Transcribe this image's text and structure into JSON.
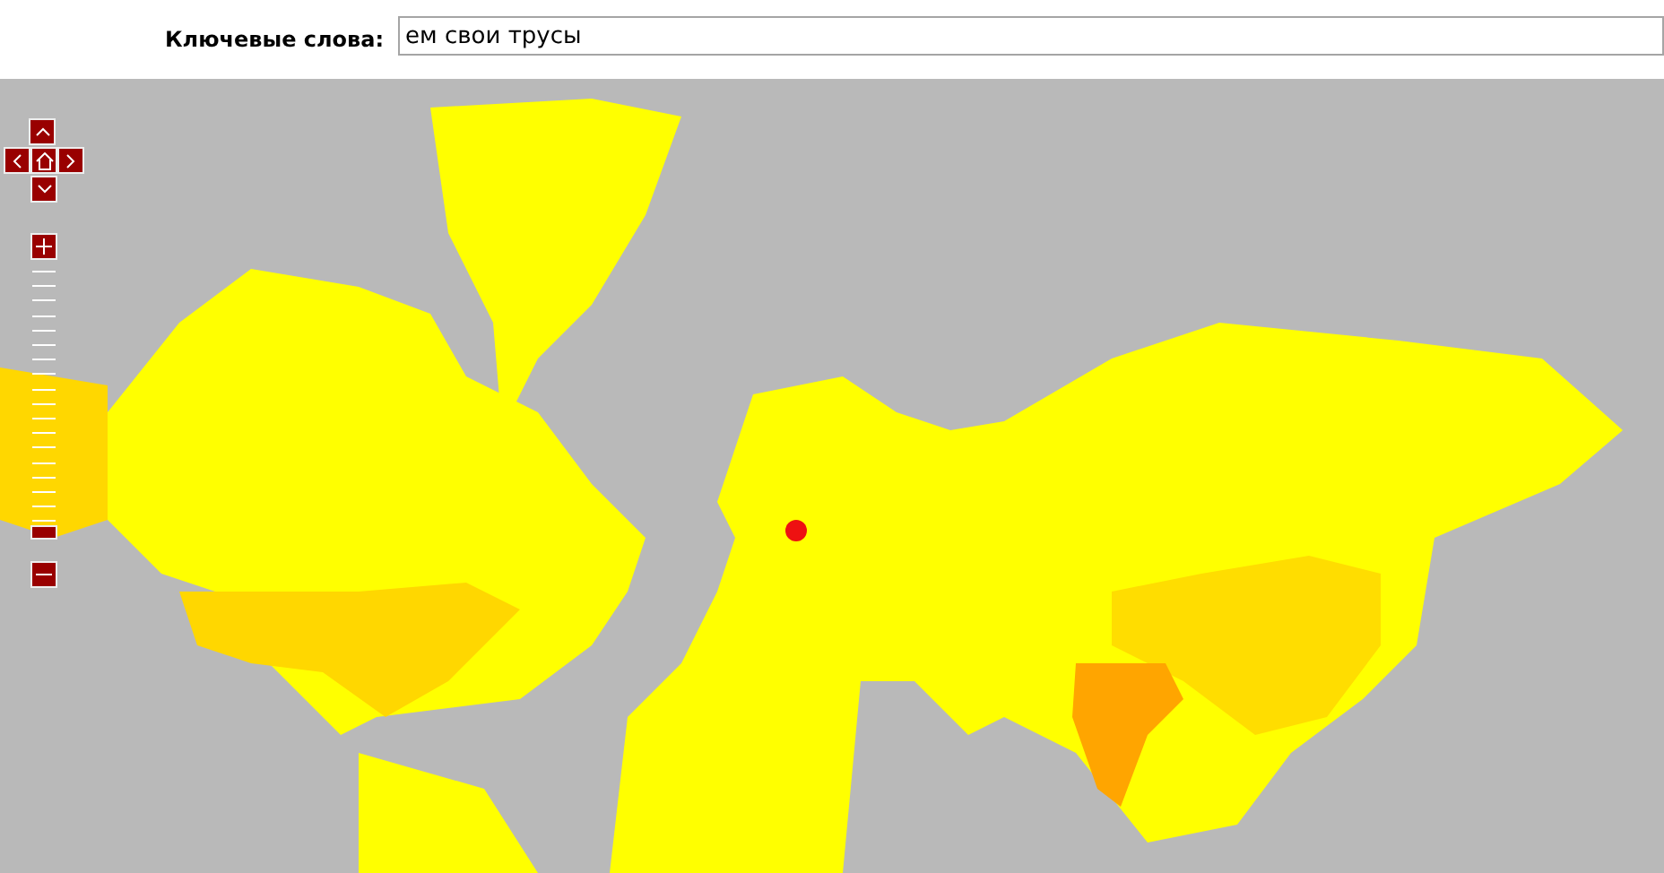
{
  "search": {
    "label": "Ключевые слова:",
    "value": "ем свои трусы"
  },
  "map": {
    "zoom": {
      "level": 0
    }
  }
}
